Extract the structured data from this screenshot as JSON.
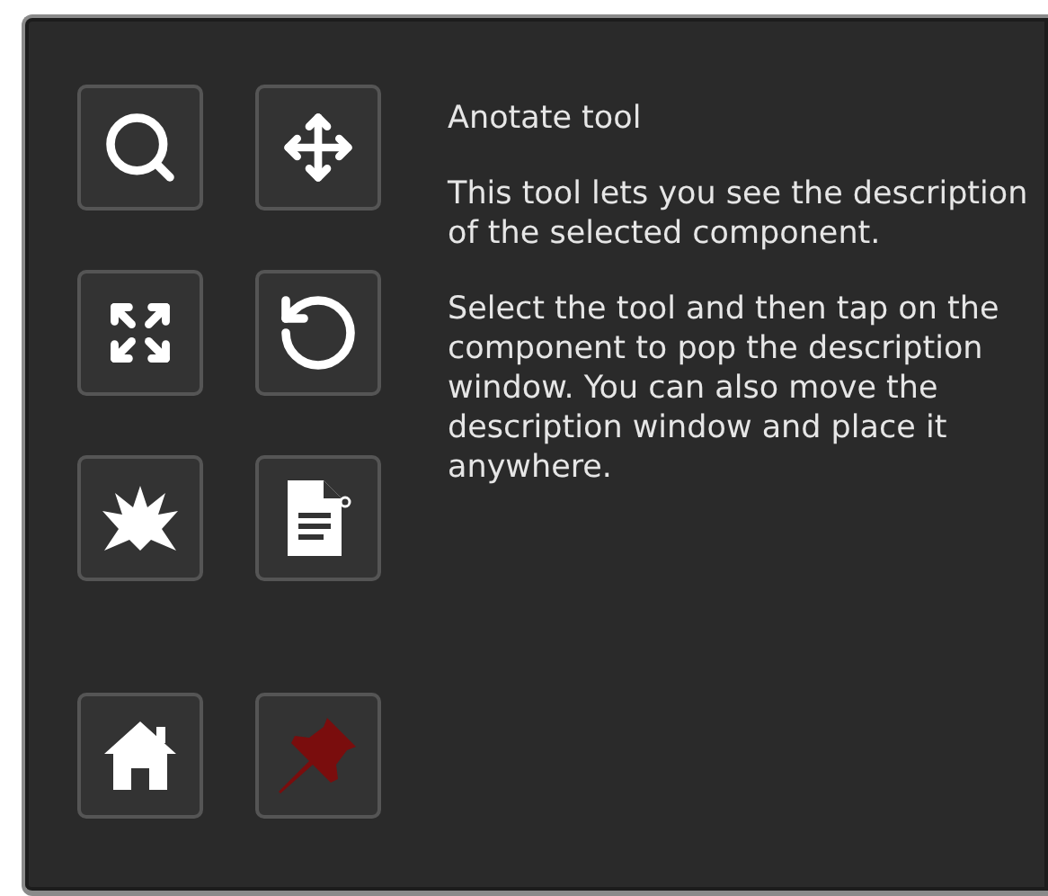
{
  "tool_groups": [
    {
      "rows": [
        [
          {
            "kind": "search"
          },
          {
            "kind": "move"
          }
        ],
        [
          {
            "kind": "expand"
          },
          {
            "kind": "rotate"
          }
        ],
        [
          {
            "kind": "explode"
          },
          {
            "kind": "document"
          }
        ]
      ]
    },
    {
      "rows": [
        [
          {
            "kind": "home"
          },
          {
            "kind": "pin"
          }
        ]
      ]
    }
  ],
  "description": {
    "title": "Anotate tool",
    "paragraphs": [
      "This tool lets you see the description of the selected component.",
      "Select the tool and then tap on the component to pop the description window. You can also move the description window and place it anywhere."
    ]
  }
}
